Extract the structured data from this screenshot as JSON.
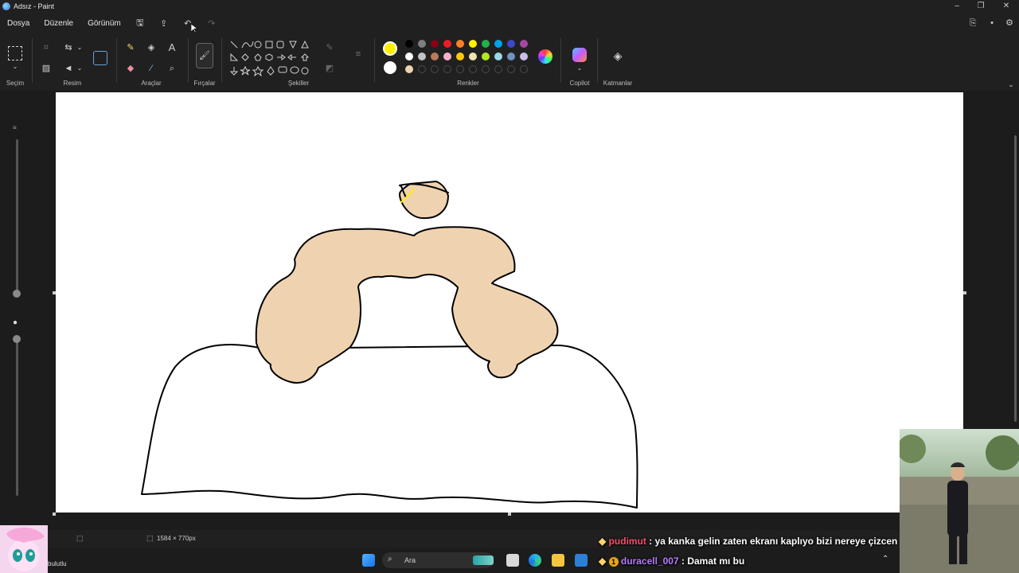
{
  "window": {
    "title": "Adsız - Paint"
  },
  "menu": {
    "file": "Dosya",
    "edit": "Düzenle",
    "view": "Görünüm"
  },
  "ribbon": {
    "groups": {
      "selection": "Seçim",
      "image": "Resim",
      "tools": "Araçlar",
      "brushes": "Fırçalar",
      "shapes": "Şekiller",
      "colors": "Renkler",
      "copilot": "Copilot",
      "layers": "Katmanlar"
    },
    "text_tool_glyph": "A",
    "primary_color": "#ffef00",
    "secondary_color": "#ffffff",
    "palette_row1": [
      "#000000",
      "#7f7f7f",
      "#880015",
      "#ed1c24",
      "#ff7f27",
      "#fff200",
      "#22b14c",
      "#00a2e8",
      "#3f48cc",
      "#a349a4"
    ],
    "palette_row2": [
      "#ffffff",
      "#c3c3c3",
      "#b97a57",
      "#ffaec9",
      "#ffc90e",
      "#efe4b0",
      "#b5e61d",
      "#99d9ea",
      "#7092be",
      "#c8bfe7"
    ],
    "palette_row3": [
      "#efd3b0",
      "",
      "",
      "",
      "",
      "",
      "",
      "",
      "",
      ""
    ]
  },
  "drawing": {
    "skin_color": "#efd3b0",
    "outline_color": "#000000",
    "accent_color": "#ffef00"
  },
  "status": {
    "canvas_size": "1584 × 770px"
  },
  "taskbar": {
    "search_placeholder": "Ara",
    "weather_text": "bulutlu"
  },
  "stream_chat": [
    {
      "user": "pudimut",
      "message": ": ya kanka gelin zaten ekranı kaplıyo bizi nereye çizcen"
    },
    {
      "user": "duracell_007",
      "message": ": Damat mı bu"
    }
  ]
}
